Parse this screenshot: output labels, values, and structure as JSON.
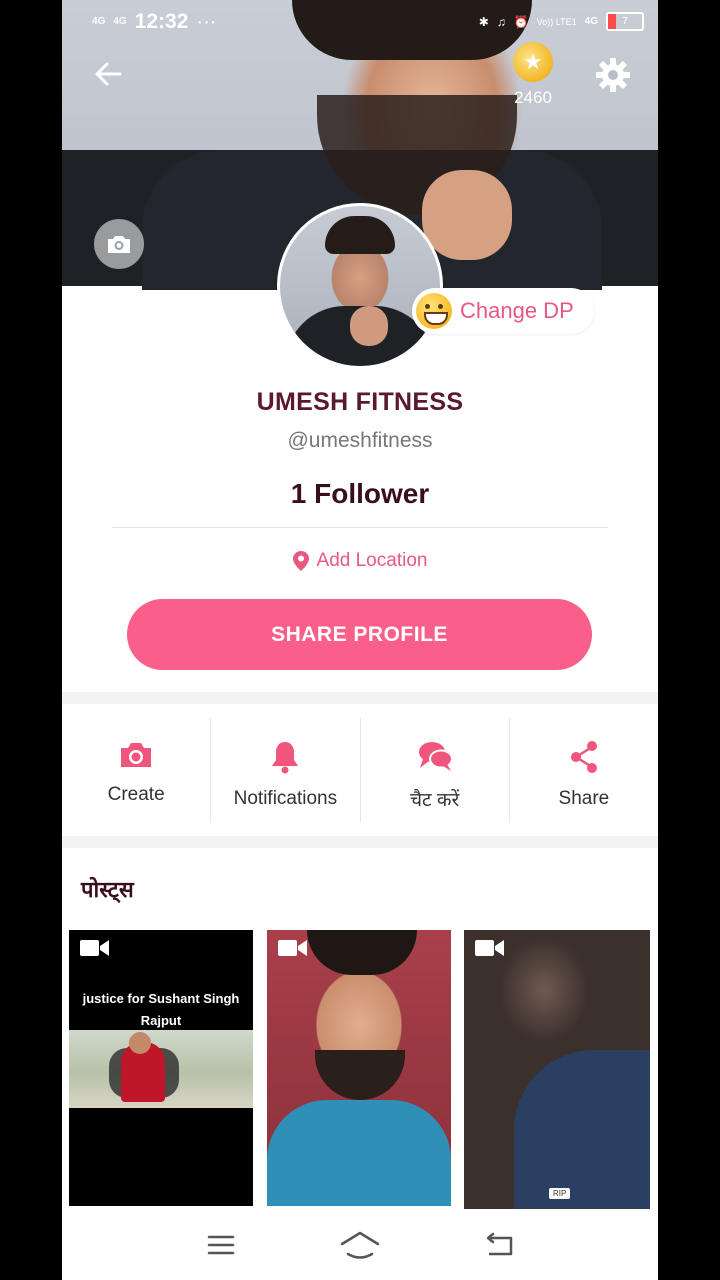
{
  "status_bar": {
    "net1": "4G",
    "net2": "4G",
    "time": "12:32",
    "dots": "···",
    "volte": "Vo)) LTE1",
    "net3": "4G",
    "battery": "7"
  },
  "header": {
    "coin_count": "2460"
  },
  "profile": {
    "change_dp_label": "Change DP",
    "name": "UMESH FITNESS",
    "handle": "@umeshfitness",
    "followers": "1 Follower",
    "location_label": "Add Location",
    "share_button_label": "SHARE PROFILE"
  },
  "actions": [
    {
      "label": "Create",
      "icon": "camera-icon"
    },
    {
      "label": "Notifications",
      "icon": "bell-icon"
    },
    {
      "label": "चैट करें",
      "icon": "chat-icon"
    },
    {
      "label": "Share",
      "icon": "share-icon"
    }
  ],
  "posts": {
    "title": "पोस्ट्स",
    "items": [
      {
        "caption": "justice for Sushant Singh Rajput",
        "type": "video"
      },
      {
        "caption": "",
        "type": "video"
      },
      {
        "caption": "",
        "type": "video",
        "badge": "RIP"
      }
    ]
  },
  "colors": {
    "accent": "#fa5f8a",
    "accent_text": "#e8597f",
    "name_color": "#5b1a2b"
  }
}
